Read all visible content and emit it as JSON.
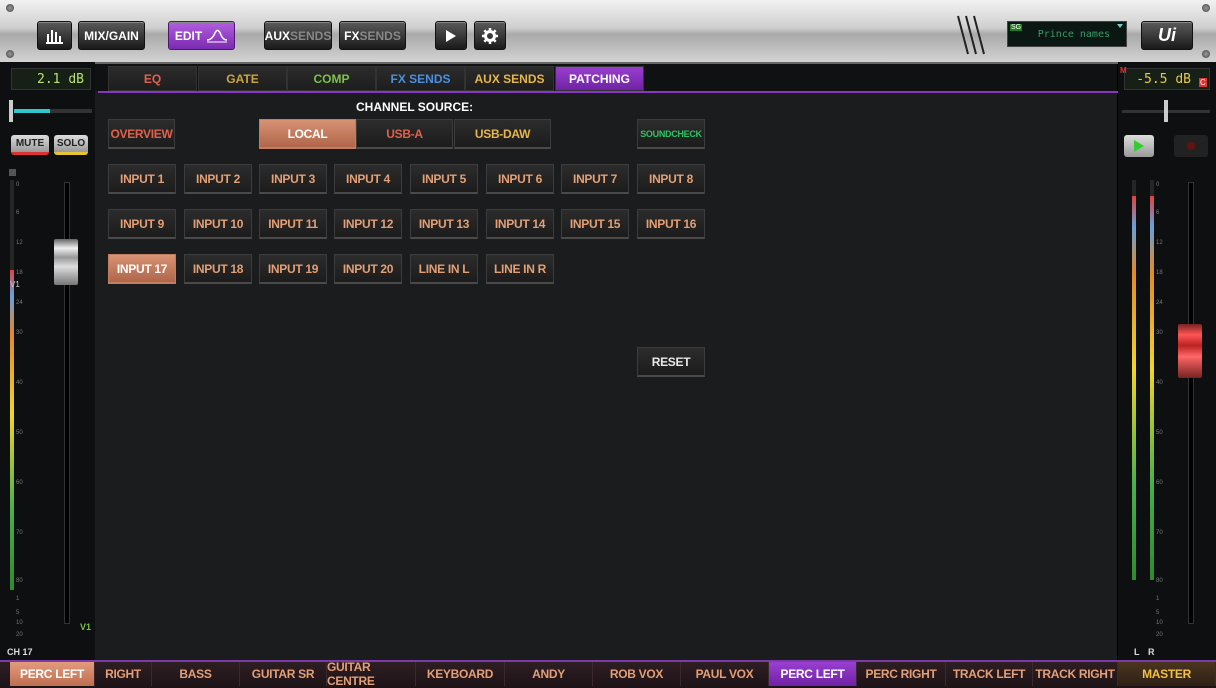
{
  "topbar": {
    "mixgain": "MIX/GAIN",
    "edit": "EDIT",
    "aux_a": "AUX",
    "aux_b": "SENDS",
    "fx_a": "FX",
    "fx_b": "SENDS",
    "snapshot": "Prince names",
    "snapshot_badge": "SG",
    "logo": "Ui"
  },
  "tabs": [
    {
      "label": "EQ",
      "color": "#e0614b"
    },
    {
      "label": "GATE",
      "color": "#c9a544"
    },
    {
      "label": "COMP",
      "color": "#7bc14a"
    },
    {
      "label": "FX SENDS",
      "color": "#4a8fe0"
    },
    {
      "label": "AUX SENDS",
      "color": "#e6b64a"
    },
    {
      "label": "PATCHING",
      "color": "#ffffff"
    }
  ],
  "patching": {
    "heading": "CHANNEL SOURCE:",
    "overview": "OVERVIEW",
    "sources": [
      "LOCAL",
      "USB-A",
      "USB-DAW"
    ],
    "soundcheck": "SOUNDCHECK",
    "inputs": [
      "INPUT 1",
      "INPUT 2",
      "INPUT 3",
      "INPUT 4",
      "INPUT 5",
      "INPUT 6",
      "INPUT 7",
      "INPUT 8",
      "INPUT 9",
      "INPUT 10",
      "INPUT 11",
      "INPUT 12",
      "INPUT 13",
      "INPUT 14",
      "INPUT 15",
      "INPUT 16",
      "INPUT 17",
      "INPUT 18",
      "INPUT 19",
      "INPUT 20",
      "LINE IN L",
      "LINE IN R"
    ],
    "reset": "RESET"
  },
  "left_strip": {
    "gain_readout": "2.1 dB",
    "mute": "MUTE",
    "solo": "SOLO",
    "channel": "CH 17",
    "v1_top": "V1",
    "v1_bottom": "V1",
    "scale": [
      "0",
      "6",
      "12",
      "18",
      "24",
      "30",
      "40",
      "50",
      "60",
      "70",
      "80",
      "1",
      "5",
      "10",
      "20"
    ]
  },
  "right_strip": {
    "gain_readout": "-5.5 dB",
    "m_badge": "M",
    "c_badge": "C",
    "l": "L",
    "r": "R",
    "scale": [
      "0",
      "6",
      "12",
      "18",
      "24",
      "30",
      "40",
      "50",
      "60",
      "70",
      "80",
      "1",
      "5",
      "10",
      "20"
    ]
  },
  "bottom_tabs": [
    "PERC LEFT",
    "RIGHT",
    "BASS",
    "GUITAR SR",
    "GUITAR CENTRE",
    "KEYBOARD",
    "ANDY",
    "ROB VOX",
    "PAUL VOX",
    "PERC LEFT",
    "PERC RIGHT",
    "TRACK LEFT",
    "TRACK RIGHT",
    "MASTER"
  ]
}
